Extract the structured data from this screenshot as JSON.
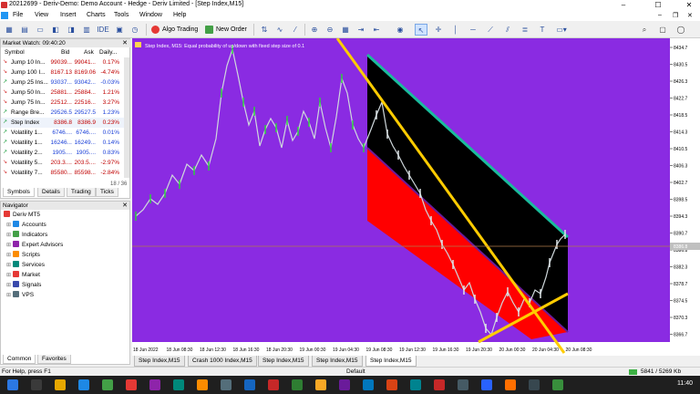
{
  "titlebar": {
    "title": "20212699 - Deriv-Demo: Demo Account - Hedge - Deriv Limited - [Step Index,M15]"
  },
  "menu": [
    "File",
    "View",
    "Insert",
    "Charts",
    "Tools",
    "Window",
    "Help"
  ],
  "toolbar": {
    "ide_label": "IDE",
    "algo_label": "Algo Trading",
    "neworder_label": "New Order"
  },
  "market_watch": {
    "title": "Market Watch: 09:40:20",
    "headers": {
      "symbol": "Symbol",
      "bid": "Bid",
      "ask": "Ask",
      "daily": "Daily..."
    },
    "rows": [
      {
        "dir": "down",
        "symbol": "Jump 10 In...",
        "bid": "99039...",
        "ask": "99041...",
        "daily": "0.17%",
        "color": "#c00000"
      },
      {
        "dir": "down",
        "symbol": "Jump 100 I...",
        "bid": "8167.13",
        "ask": "8169.06",
        "daily": "-4.74%",
        "color": "#c00000"
      },
      {
        "dir": "up",
        "symbol": "Jump 25 Ins...",
        "bid": "93037...",
        "ask": "93042...",
        "daily": "-0.03%",
        "color": "#1a3fd8"
      },
      {
        "dir": "down",
        "symbol": "Jump 50 In...",
        "bid": "25881...",
        "ask": "25884...",
        "daily": "1.21%",
        "color": "#c00000"
      },
      {
        "dir": "down",
        "symbol": "Jump 75 In...",
        "bid": "22512...",
        "ask": "22516...",
        "daily": "3.27%",
        "color": "#c00000"
      },
      {
        "dir": "up",
        "symbol": "Range Bre...",
        "bid": "29526.5",
        "ask": "29527.5",
        "daily": "1.23%",
        "color": "#1a3fd8"
      },
      {
        "dir": "up",
        "symbol": "Step Index",
        "bid": "8386.8",
        "ask": "8386.9",
        "daily": "0.23%",
        "color": "#c00000"
      },
      {
        "dir": "up",
        "symbol": "Volatility 1...",
        "bid": "6746....",
        "ask": "6746....",
        "daily": "0.01%",
        "color": "#1a3fd8"
      },
      {
        "dir": "up",
        "symbol": "Volatility 1...",
        "bid": "16246...",
        "ask": "16249...",
        "daily": "0.14%",
        "color": "#1a3fd8"
      },
      {
        "dir": "up",
        "symbol": "Volatility 2...",
        "bid": "1905....",
        "ask": "1905....",
        "daily": "0.83%",
        "color": "#1a3fd8"
      },
      {
        "dir": "down",
        "symbol": "Volatility 5...",
        "bid": "203.3....",
        "ask": "203.5....",
        "daily": "-2.97%",
        "color": "#c00000"
      },
      {
        "dir": "down",
        "symbol": "Volatility 7...",
        "bid": "85580...",
        "ask": "85598...",
        "daily": "-2.84%",
        "color": "#c00000"
      }
    ],
    "count": "18 / 36",
    "tabs": [
      "Symbols",
      "Details",
      "Trading",
      "Ticks"
    ]
  },
  "navigator": {
    "title": "Navigator",
    "root": "Deriv MT5",
    "items": [
      "Accounts",
      "Indicators",
      "Expert Advisors",
      "Scripts",
      "Services",
      "Market",
      "Signals",
      "VPS"
    ],
    "tabs": [
      "Common",
      "Favorites"
    ]
  },
  "chart": {
    "label": "Step Index, M15:  Equal probability of up/down with fixed step size of 0.1",
    "background": "#8a2be2",
    "price_labels": [
      "8434.7",
      "8430.5",
      "8426.3",
      "8422.7",
      "8418.5",
      "8414.3",
      "8410.5",
      "8406.3",
      "8402.7",
      "8398.5",
      "8394.3",
      "8390.7",
      "8386.8",
      "8382.3",
      "8378.7",
      "8374.5",
      "8370.3",
      "8366.7"
    ],
    "current_price": "8386.8",
    "time_labels": [
      "18 Jun 2022",
      "18 Jun 08:30",
      "18 Jun 12:30",
      "18 Jun 16:30",
      "18 Jun 20:30",
      "19 Jun 00:30",
      "19 Jun 04:30",
      "19 Jun 08:30",
      "19 Jun 12:30",
      "19 Jun 16:30",
      "19 Jun 20:30",
      "20 Jun 00:30",
      "20 Jun 04:30",
      "20 Jun 08:30"
    ]
  },
  "chart_tabs": [
    "Step Index,M15",
    "Crash 1000 Index,M15",
    "Step Index,M15",
    "Step Index,M15",
    "Step Index,M15"
  ],
  "status": {
    "help": "For Help, press F1",
    "profile": "Default",
    "traffic": "5841 / 5269 Kb"
  },
  "taskbar": {
    "clock": "11:40"
  }
}
